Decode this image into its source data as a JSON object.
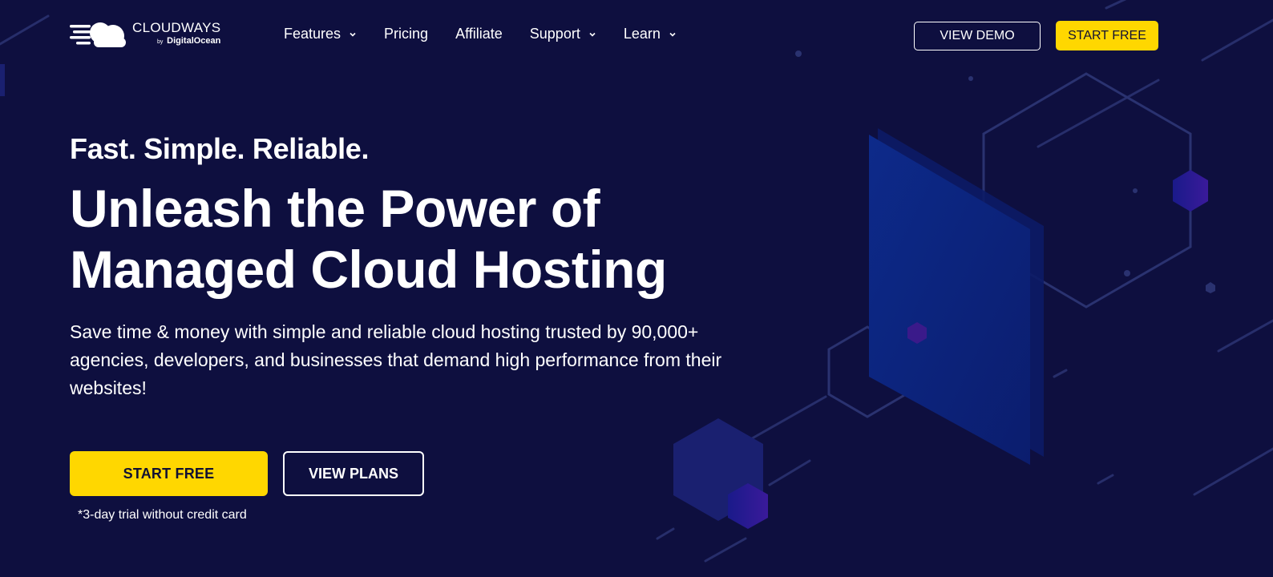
{
  "brand": {
    "name": "CLOUDWAYS",
    "by": "by",
    "parent": "DigitalOcean",
    "logo_icon": "cloud-speed-icon"
  },
  "nav": {
    "features": "Features",
    "pricing": "Pricing",
    "affiliate": "Affiliate",
    "support": "Support",
    "learn": "Learn"
  },
  "header_actions": {
    "view_demo": "VIEW DEMO",
    "start_free": "START FREE"
  },
  "hero": {
    "eyebrow": "Fast. Simple. Reliable.",
    "headline_line1": "Unleash the Power of",
    "headline_line2": "Managed Cloud Hosting",
    "description": "Save time & money with simple and reliable cloud hosting trusted by 90,000+ agencies, developers, and businesses that demand high performance from their websites!",
    "cta_primary": "START FREE",
    "cta_secondary": "VIEW PLANS",
    "trial_note": "*3-day trial without credit card"
  },
  "colors": {
    "background": "#0e0f3f",
    "accent": "#ffd700",
    "text": "#ffffff",
    "illustration_blue": "#0f1f7a"
  }
}
